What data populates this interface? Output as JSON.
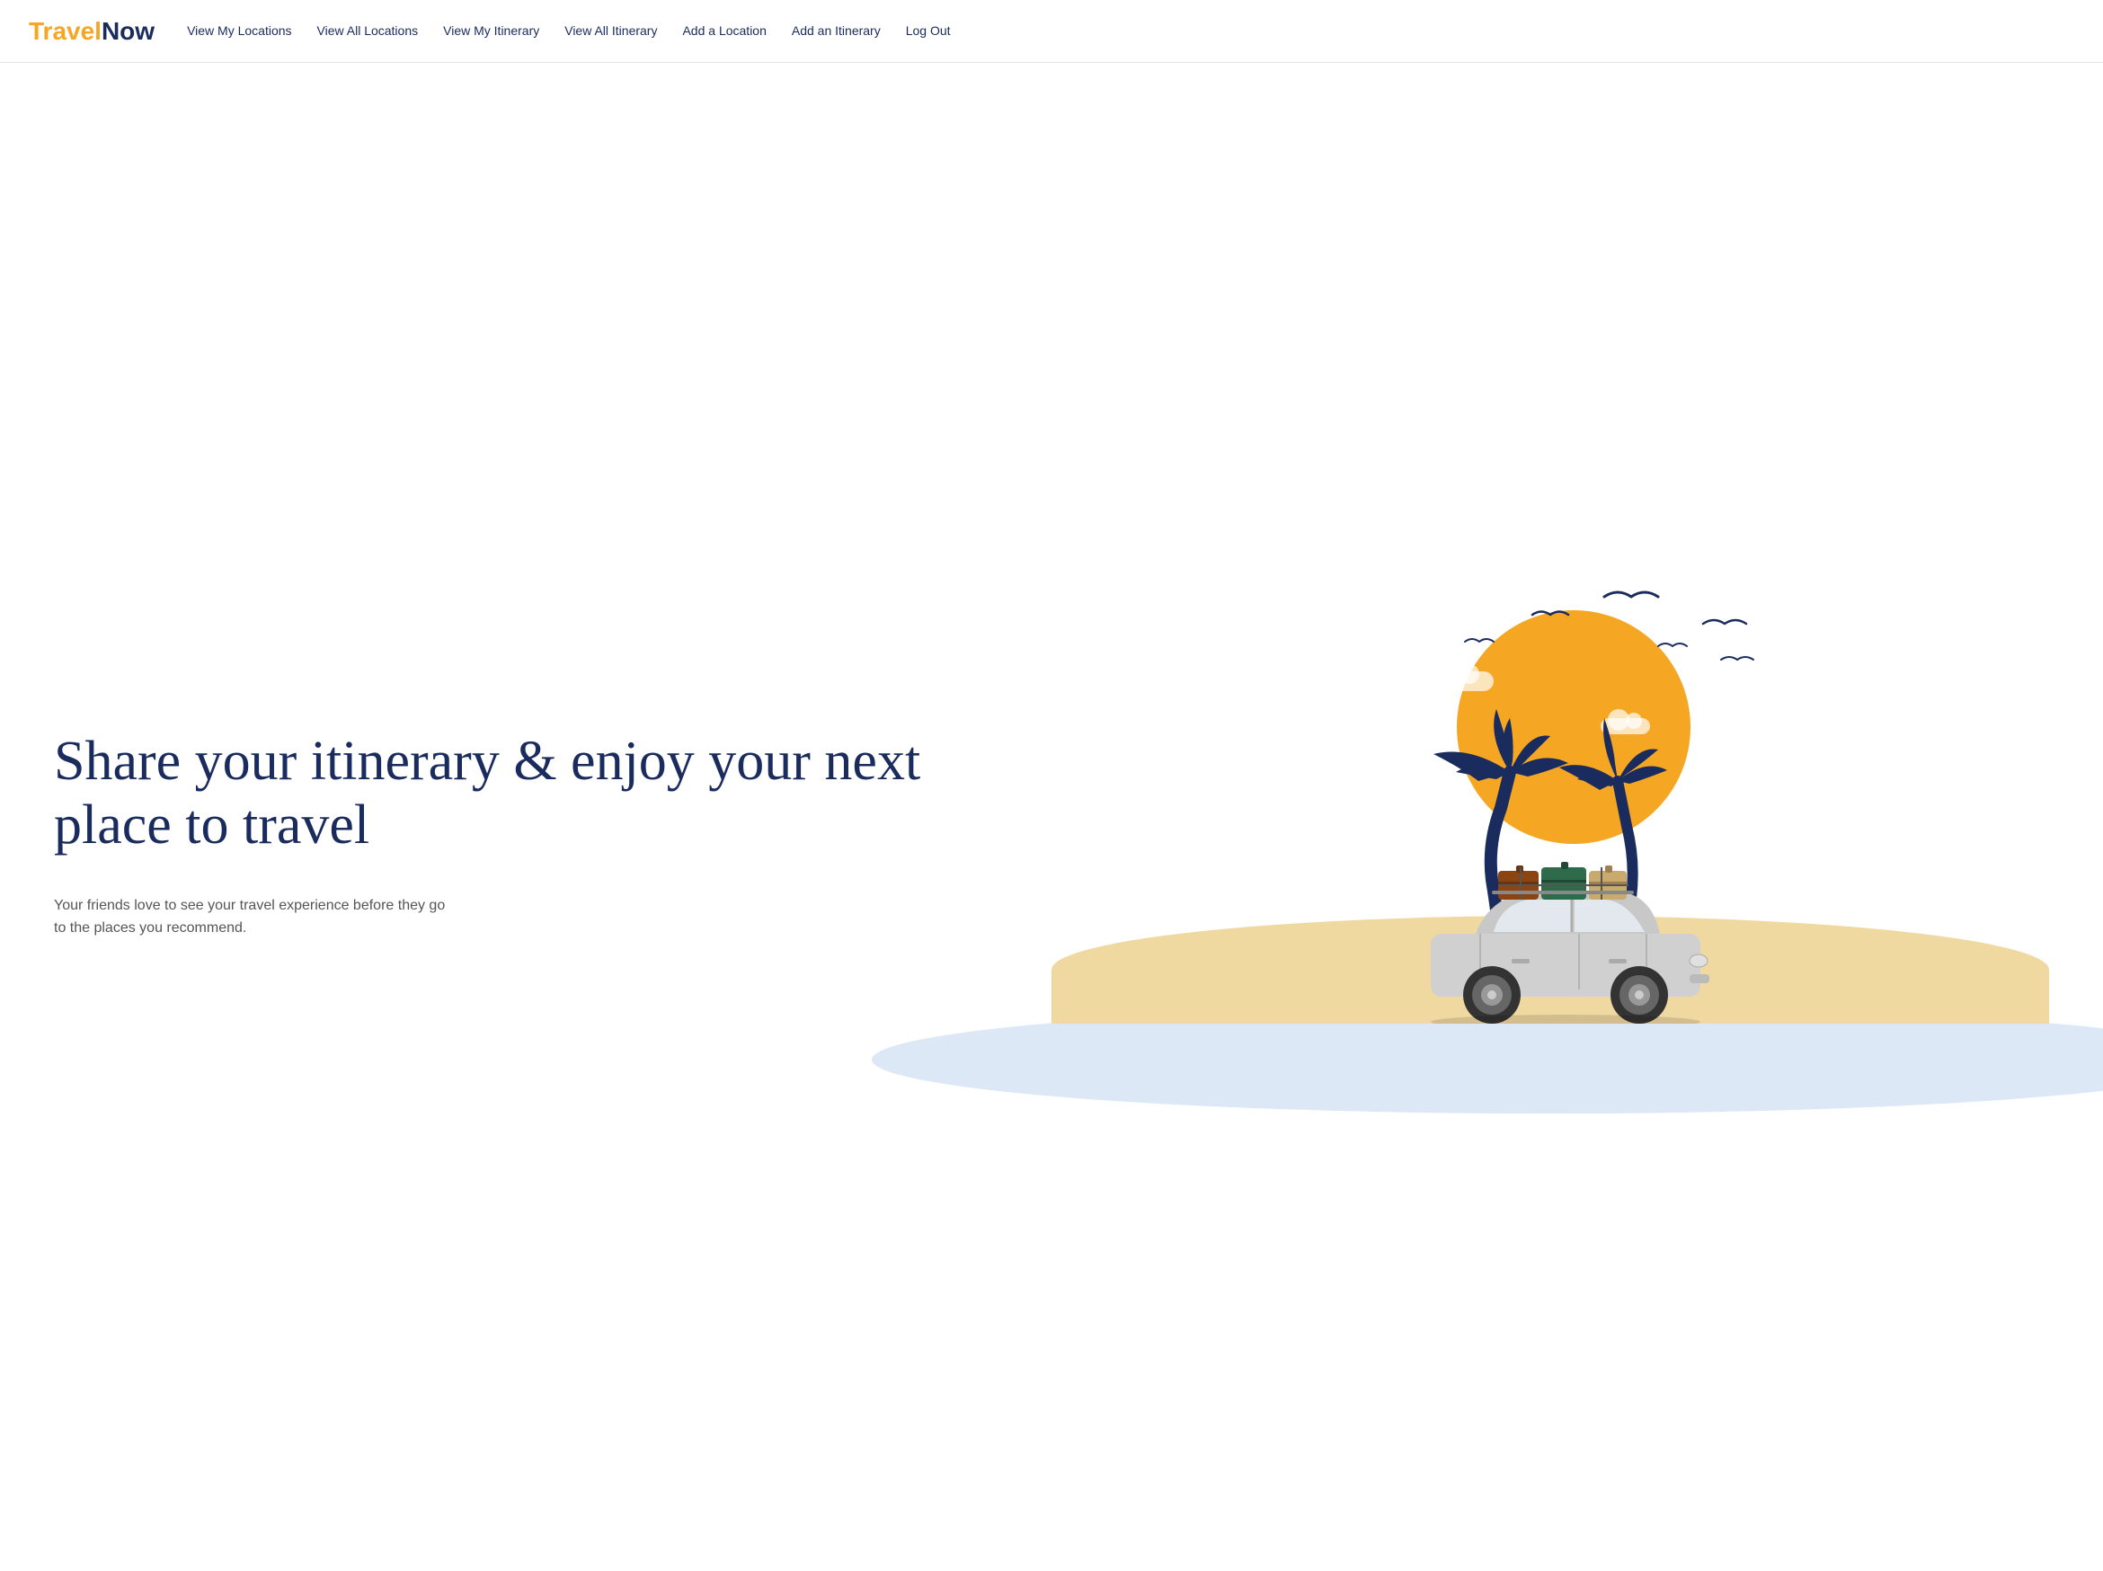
{
  "logo": {
    "travel": "Travel",
    "now": "Now"
  },
  "nav": {
    "links": [
      {
        "id": "view-my-locations",
        "label": "View My Locations"
      },
      {
        "id": "view-all-locations",
        "label": "View All Locations"
      },
      {
        "id": "view-my-itinerary",
        "label": "View My Itinerary"
      },
      {
        "id": "view-all-itinerary",
        "label": "View All Itinerary"
      },
      {
        "id": "add-a-location",
        "label": "Add a Location"
      },
      {
        "id": "add-an-itinerary",
        "label": "Add an Itinerary"
      },
      {
        "id": "log-out",
        "label": "Log Out"
      }
    ]
  },
  "hero": {
    "title": "Share your itinerary & enjoy your next place to travel",
    "subtitle": "Your friends love to see your travel experience before they go to the places you recommend."
  },
  "colors": {
    "brand_orange": "#f5a623",
    "brand_navy": "#1a2b5e",
    "sun": "#f5a623",
    "sand": "#f0d9a0",
    "blob": "#dce8f5"
  }
}
